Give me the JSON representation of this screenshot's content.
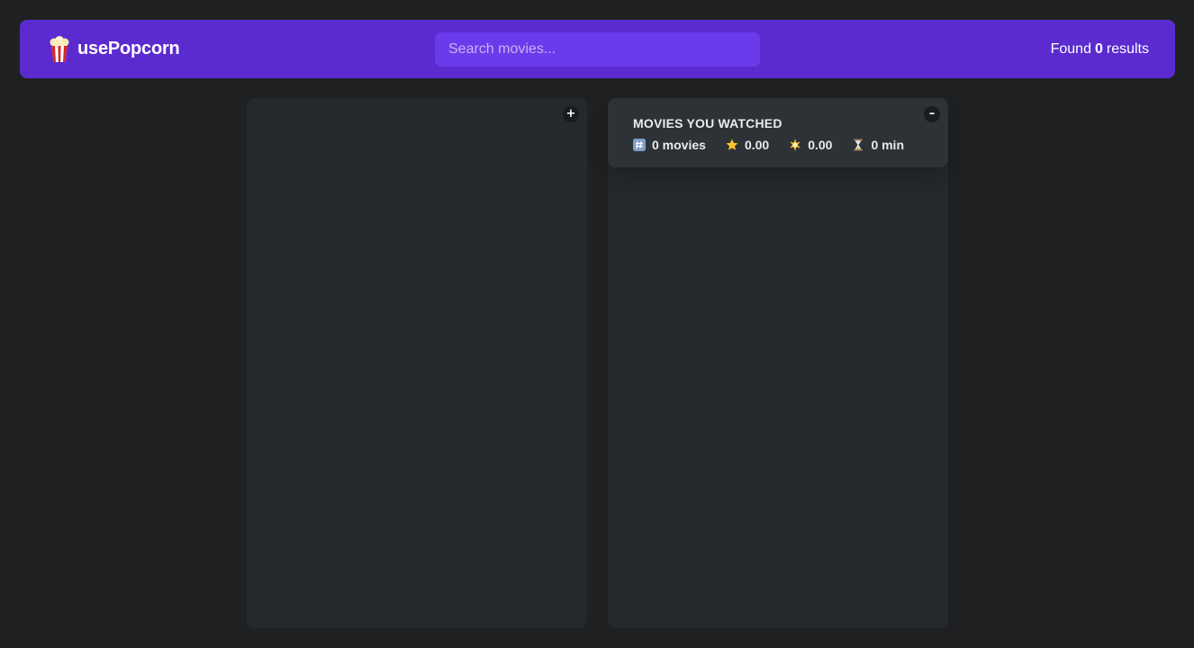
{
  "app": {
    "logo_text": "usePopcorn",
    "logo_icon": "popcorn-icon"
  },
  "search": {
    "placeholder": "Search movies...",
    "value": ""
  },
  "results": {
    "prefix": "Found",
    "count": "0",
    "suffix": "results"
  },
  "left_box": {
    "toggle_label": "+"
  },
  "right_box": {
    "toggle_label": "–",
    "summary": {
      "title": "Movies you watched",
      "movies": "0 movies",
      "imdb_rating": "0.00",
      "user_rating": "0.00",
      "runtime": "0 min"
    }
  },
  "colors": {
    "background": "#1f2022",
    "nav": "#5b2bd0",
    "search_bg": "#6a3bea",
    "box": "#25292c",
    "summary": "#2c3235"
  }
}
